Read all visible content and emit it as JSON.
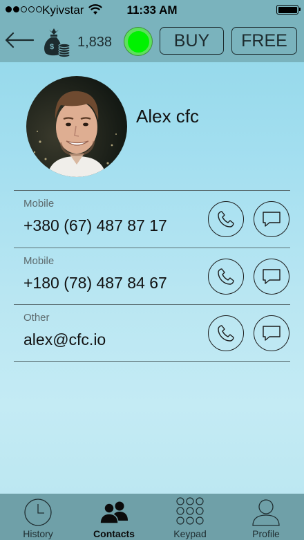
{
  "status_bar": {
    "signal_bars": 2,
    "carrier": "Kyivstar",
    "time": "11:33 AM",
    "battery_level": 1.0
  },
  "header": {
    "balance": "1,838",
    "online": true,
    "buy_label": "BUY",
    "free_label": "FREE"
  },
  "contact": {
    "name": "Alex cfc",
    "entries": [
      {
        "label": "Mobile",
        "value": "+380 (67) 487 87 17",
        "icons": [
          "phone-icon",
          "message-icon"
        ]
      },
      {
        "label": "Mobile",
        "value": "+180 (78) 487 84 67",
        "icons": [
          "phone-icon",
          "message-icon"
        ]
      },
      {
        "label": "Other",
        "value": "alex@cfc.io",
        "icons": [
          "phone-icon",
          "message-icon"
        ]
      }
    ]
  },
  "tabs": [
    {
      "label": "History",
      "icon": "clock-icon",
      "active": false
    },
    {
      "label": "Contacts",
      "icon": "people-icon",
      "active": true
    },
    {
      "label": "Keypad",
      "icon": "keypad-icon",
      "active": false
    },
    {
      "label": "Profile",
      "icon": "person-icon",
      "active": false
    }
  ],
  "colors": {
    "online_indicator": "#00f200",
    "header_bg": "#7ab3bd",
    "tabbar_bg": "#6fa0a8"
  }
}
